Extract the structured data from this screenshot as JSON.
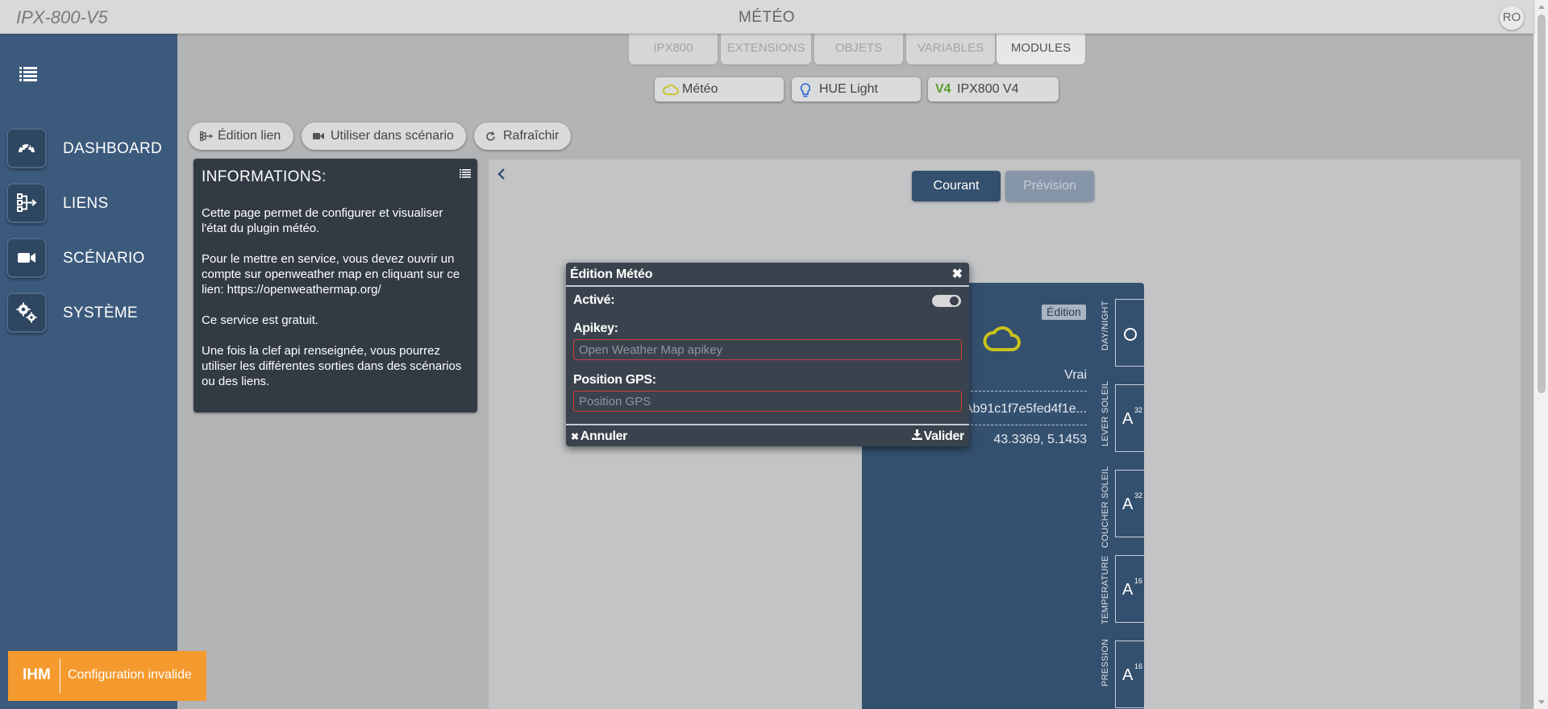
{
  "header": {
    "brand": "IPX-800-V5",
    "title": "MÉTÉO",
    "user_initials": "RO"
  },
  "sidebar": {
    "items": [
      {
        "label": "DASHBOARD",
        "icon": "gauge-icon"
      },
      {
        "label": "LIENS",
        "icon": "links-icon"
      },
      {
        "label": "SCÉNARIO",
        "icon": "video-icon"
      },
      {
        "label": "SYSTÈME",
        "icon": "gears-icon"
      }
    ]
  },
  "status": {
    "ihm": "IHM",
    "message": "Configuration invalide",
    "color": "#f59a2e"
  },
  "tabs": [
    {
      "label": "IPX800",
      "active": false
    },
    {
      "label": "EXTENSIONS",
      "active": false
    },
    {
      "label": "OBJETS",
      "active": false
    },
    {
      "label": "VARIABLES",
      "active": false
    },
    {
      "label": "MODULES",
      "active": true
    }
  ],
  "modules": [
    {
      "label": "Météo",
      "icon": "cloud-icon"
    },
    {
      "label": "HUE Light",
      "icon": "bulb-icon"
    },
    {
      "label": "IPX800 V4",
      "icon": "v4-badge-icon",
      "badge": "V4"
    }
  ],
  "toolbar": {
    "edit_link": "Édition lien",
    "use_in_scenario": "Utiliser dans scénario",
    "refresh": "Rafraîchir"
  },
  "info": {
    "title": "INFORMATIONS:",
    "paragraphs": [
      "Cette page permet de configurer et visualiser l'état du plugin météo.",
      "Pour le mettre en service, vous devez ouvrir un compte sur openweather map en cliquant sur ce lien: https://openweathermap.org/",
      "Ce service est gratuit.",
      "Une fois la clef api renseignée, vous pourrez utiliser les différentes sorties dans des scénarios ou des liens."
    ]
  },
  "view_toggle": {
    "current": "Courant",
    "forecast": "Prévision"
  },
  "weather_card": {
    "edition_badge": "Édition",
    "active_value": "Vrai",
    "apikey_value": "Ab91c1f7e5fed4f1e...",
    "gps_value": "43.3369, 5.1453",
    "side": [
      {
        "label": "DAY/NIGHT",
        "type": "circle"
      },
      {
        "label": "LEVER SOLEIL",
        "letter": "A",
        "sup": "32"
      },
      {
        "label": "COUCHER SOLEIL",
        "letter": "A",
        "sup": "32"
      },
      {
        "label": "TEMPERATURE",
        "letter": "A",
        "sup": "16"
      },
      {
        "label": "PRESSION",
        "letter": "A",
        "sup": "16"
      }
    ]
  },
  "modal": {
    "title": "Édition Météo",
    "active_label": "Activé:",
    "active_on": true,
    "apikey_label": "Apikey:",
    "apikey_placeholder": "Open Weather Map apikey",
    "gps_label": "Position GPS:",
    "gps_placeholder": "Position GPS",
    "cancel": "Annuler",
    "validate": "Valider"
  }
}
